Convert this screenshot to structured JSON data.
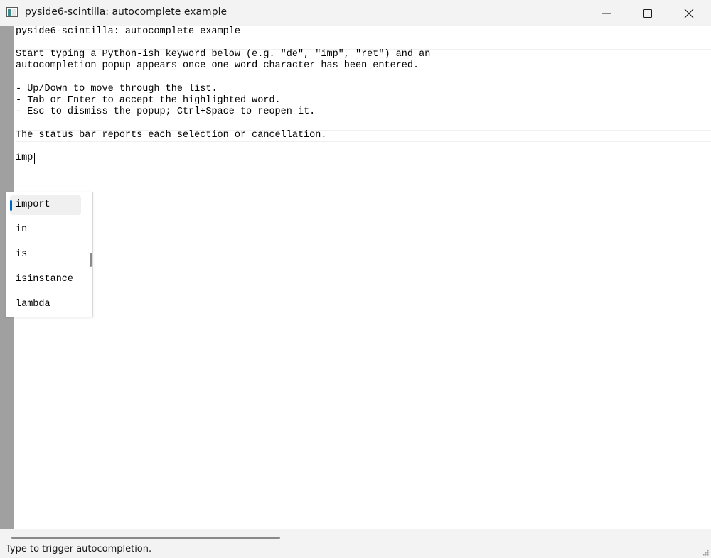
{
  "window": {
    "title": "pyside6-scintilla: autocomplete example"
  },
  "editor": {
    "lines": [
      "pyside6-scintilla: autocomplete example",
      "",
      "Start typing a Python-ish keyword below (e.g. \"de\", \"imp\", \"ret\") and an",
      "autocompletion popup appears once one word character has been entered.",
      "",
      "- Up/Down to move through the list.",
      "- Tab or Enter to accept the highlighted word.",
      "- Esc to dismiss the popup; Ctrl+Space to reopen it.",
      "",
      "The status bar reports each selection or cancellation.",
      "",
      "imp"
    ]
  },
  "autocomplete": {
    "items": [
      "import",
      "in",
      "is",
      "isinstance",
      "lambda"
    ],
    "selected_index": 0
  },
  "statusbar": {
    "text": "Type to trigger autocompletion."
  },
  "icons": {
    "app": "app-window-icon",
    "minimize": "minimize-icon",
    "maximize": "maximize-icon",
    "close": "close-icon"
  },
  "colors": {
    "selection_accent": "#0067c0",
    "margin": "#a0a0a0",
    "chrome": "#f3f3f3"
  }
}
